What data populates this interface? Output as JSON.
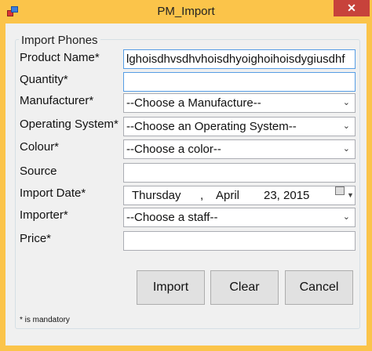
{
  "window": {
    "title": "PM_Import",
    "close_symbol": "✕"
  },
  "group": {
    "title": "Import Phones"
  },
  "form": {
    "product_name": {
      "label": "Product Name*",
      "value": "lghoisdhvsdhvhoisdhyoighoihoisdygiusdhf"
    },
    "quantity": {
      "label": "Quantity*",
      "value": ""
    },
    "manufacturer": {
      "label": "Manufacturer*",
      "selected": "--Choose a Manufacture--"
    },
    "operating_system": {
      "label": "Operating System*",
      "selected": "--Choose an Operating System--"
    },
    "colour": {
      "label": "Colour*",
      "selected": "--Choose a color--"
    },
    "source": {
      "label": "Source",
      "value": ""
    },
    "import_date": {
      "label": "Import Date*",
      "weekday": "Thursday",
      "sep": ",",
      "month": "April",
      "day_year": "23, 2015"
    },
    "importer": {
      "label": "Importer*",
      "selected": "--Choose a staff--"
    },
    "price": {
      "label": "Price*",
      "value": ""
    }
  },
  "buttons": {
    "import": "Import",
    "clear": "Clear",
    "cancel": "Cancel"
  },
  "footnote": "* is mandatory",
  "icons": {
    "dropdown": "chevron-down-icon",
    "calendar": "calendar-icon",
    "app": "app-icon",
    "close": "close-icon"
  }
}
